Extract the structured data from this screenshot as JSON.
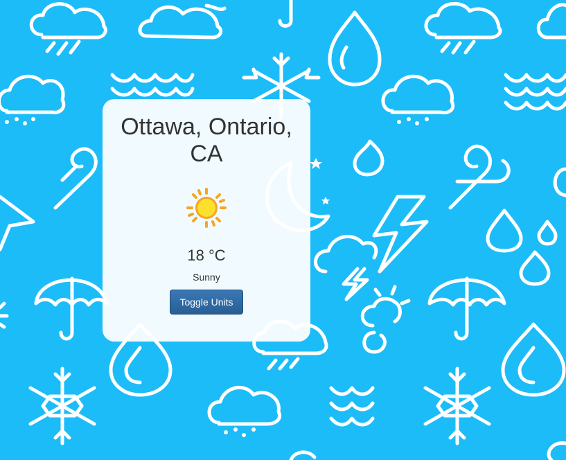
{
  "location": {
    "city": "Ottawa, Ontario, CA"
  },
  "weather": {
    "icon": "sun-icon",
    "temperature_value": "18",
    "temperature_unit": "°C",
    "condition": "Sunny"
  },
  "controls": {
    "toggle_label": "Toggle Units"
  },
  "colors": {
    "background": "#1cbcf8",
    "card": "#f3fbff",
    "button": "#2f6ca6",
    "sun": "#f7c21b"
  }
}
